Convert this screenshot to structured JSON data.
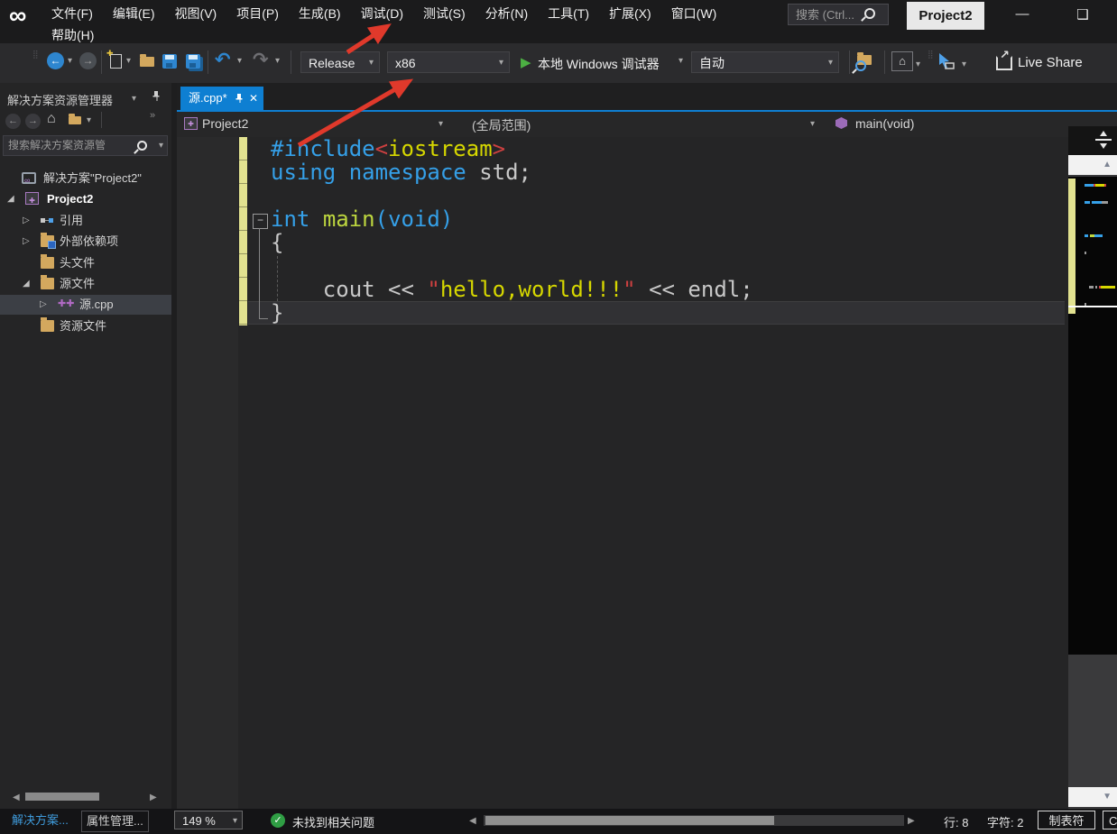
{
  "titlebar": {
    "menus": [
      "文件(F)",
      "编辑(E)",
      "视图(V)",
      "项目(P)",
      "生成(B)",
      "调试(D)",
      "测试(S)",
      "分析(N)",
      "工具(T)",
      "扩展(X)",
      "窗口(W)",
      "帮助(H)"
    ],
    "search_placeholder": "搜索 (Ctrl...",
    "window_title": "Project2",
    "minimize_glyph": "—",
    "maximize_glyph": "❑"
  },
  "toolbar": {
    "configuration": "Release",
    "platform": "x86",
    "start_label": "本地 Windows 调试器",
    "auto_label": "自动",
    "live_share_label": "Live Share"
  },
  "solution_explorer": {
    "title": "解决方案资源管理器",
    "search_placeholder": "搜索解决方案资源管",
    "tree": [
      {
        "label": "解决方案\"Project2\"",
        "icon": "solution",
        "depth": 0
      },
      {
        "label": "Project2",
        "icon": "project",
        "depth": 1,
        "expander": "expanded",
        "bold": true
      },
      {
        "label": "引用",
        "icon": "references",
        "depth": 2,
        "expander": "collapsed"
      },
      {
        "label": "外部依赖项",
        "icon": "folder-ext",
        "depth": 2,
        "expander": "collapsed"
      },
      {
        "label": "头文件",
        "icon": "folder",
        "depth": 2
      },
      {
        "label": "源文件",
        "icon": "folder",
        "depth": 2,
        "expander": "expanded"
      },
      {
        "label": "源.cpp",
        "icon": "cpp-file",
        "depth": 3,
        "expander": "collapsed",
        "selected": true
      },
      {
        "label": "资源文件",
        "icon": "folder",
        "depth": 2
      }
    ],
    "bottom_tabs": [
      "解决方案...",
      "属性管理..."
    ]
  },
  "editor": {
    "tab_label": "源.cpp*",
    "breadcrumb": {
      "project": "Project2",
      "scope": "(全局范围)",
      "symbol": "main(void)"
    },
    "current_line": 8,
    "code": [
      [
        {
          "t": "#include",
          "c": "kw"
        },
        {
          "t": "<",
          "c": "q"
        },
        {
          "t": "iostream",
          "c": "s"
        },
        {
          "t": ">",
          "c": "q"
        }
      ],
      [
        {
          "t": "using",
          "c": "kw"
        },
        {
          "t": " ",
          "c": "p"
        },
        {
          "t": "namespace",
          "c": "kw"
        },
        {
          "t": " std",
          "c": "p"
        },
        {
          "t": ";",
          "c": "p"
        }
      ],
      [],
      [
        {
          "t": "int",
          "c": "kw"
        },
        {
          "t": " ",
          "c": "p"
        },
        {
          "t": "main",
          "c": "fn"
        },
        {
          "t": "(",
          "c": "kw"
        },
        {
          "t": "void",
          "c": "kw"
        },
        {
          "t": ")",
          "c": "kw"
        }
      ],
      [
        {
          "t": "{",
          "c": "p"
        }
      ],
      [],
      [
        {
          "t": "    ",
          "c": "p"
        },
        {
          "t": "cout",
          "c": "p"
        },
        {
          "t": " ",
          "c": "p"
        },
        {
          "t": "<<",
          "c": "p"
        },
        {
          "t": " ",
          "c": "p"
        },
        {
          "t": "\"",
          "c": "q"
        },
        {
          "t": "hello,world!!!",
          "c": "s"
        },
        {
          "t": "\"",
          "c": "q"
        },
        {
          "t": " ",
          "c": "p"
        },
        {
          "t": "<<",
          "c": "p"
        },
        {
          "t": " ",
          "c": "p"
        },
        {
          "t": "endl",
          "c": "p"
        },
        {
          "t": ";",
          "c": "p"
        }
      ],
      [
        {
          "t": "}",
          "c": "p"
        }
      ]
    ]
  },
  "statusbar": {
    "zoom": "149 %",
    "message": "未找到相关问题",
    "line_label": "行: 8",
    "column_label": "字符: 2",
    "tabs_label": "制表符",
    "encoding_partial": "C"
  },
  "colors": {
    "accent_tab_blue": "#0e7fd2",
    "annotation_arrow_red": "#e0392b",
    "keyword_blue": "#35a0e8",
    "function_lime": "#bdd63f",
    "string_yellow": "#d6d700",
    "string_quote_red": "#cd4040",
    "plain_gray": "#c8c8c8",
    "changed_line_yellow": "#e2e290",
    "status_check_green": "#2f9e44"
  }
}
